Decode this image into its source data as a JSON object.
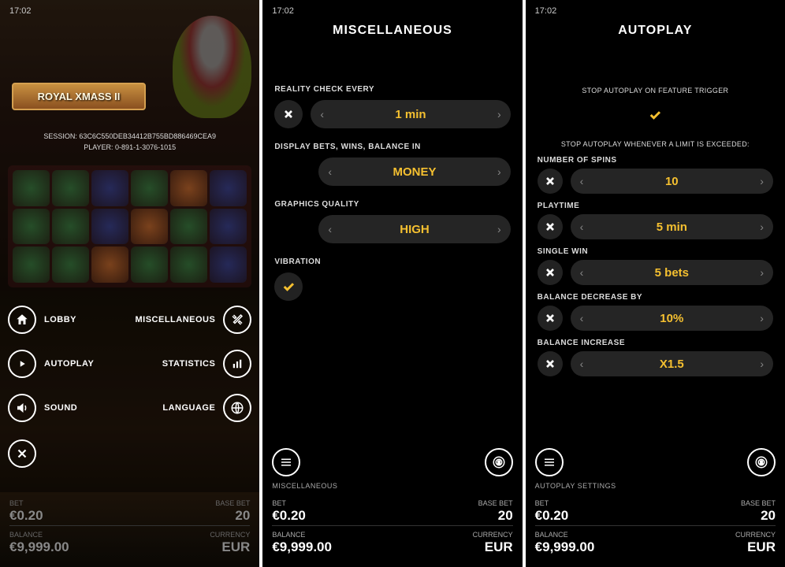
{
  "time": "17:02",
  "panel1": {
    "logo": "ROYAL XMASS II",
    "session": "SESSION: 63C6C550DEB34412B755BD886469CEA9",
    "player": "PLAYER: 0-891-1-3076-1015",
    "menu": {
      "lobby": "LOBBY",
      "miscellaneous": "MISCELLANEOUS",
      "autoplay": "AUTOPLAY",
      "statistics": "STATISTICS",
      "sound": "SOUND",
      "language": "LANGUAGE"
    }
  },
  "panel2": {
    "title": "MISCELLANEOUS",
    "reality_check": {
      "label": "REALITY CHECK EVERY",
      "value": "1 min"
    },
    "display_mode": {
      "label": "DISPLAY BETS, WINS, BALANCE IN",
      "value": "MONEY"
    },
    "graphics": {
      "label": "GRAPHICS QUALITY",
      "value": "HIGH"
    },
    "vibration": {
      "label": "VIBRATION"
    },
    "crumb": "MISCELLANEOUS"
  },
  "panel3": {
    "title": "AUTOPLAY",
    "stop_feature": "STOP AUTOPLAY ON FEATURE TRIGGER",
    "stop_limit": "STOP AUTOPLAY WHENEVER A LIMIT IS EXCEEDED:",
    "spins": {
      "label": "NUMBER OF SPINS",
      "value": "10"
    },
    "playtime": {
      "label": "PLAYTIME",
      "value": "5 min"
    },
    "single_win": {
      "label": "SINGLE WIN",
      "value": "5 bets"
    },
    "bal_dec": {
      "label": "BALANCE DECREASE BY",
      "value": "10%"
    },
    "bal_inc": {
      "label": "BALANCE INCREASE",
      "value": "X1.5"
    },
    "crumb": "AUTOPLAY SETTINGS"
  },
  "stats": {
    "bet_label": "BET",
    "bet_value": "€0.20",
    "basebet_label": "BASE BET",
    "basebet_value": "20",
    "balance_label": "BALANCE",
    "balance_value": "€9,999.00",
    "currency_label": "CURRENCY",
    "currency_value": "EUR"
  }
}
